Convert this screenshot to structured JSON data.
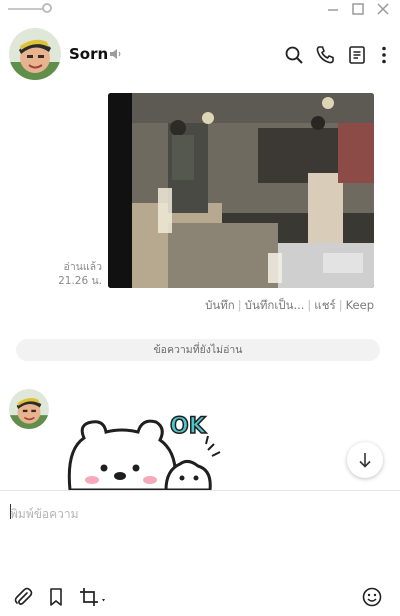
{
  "header": {
    "contact_name": "Sorn",
    "icons": [
      "search-icon",
      "phone-icon",
      "notes-icon",
      "more-icon"
    ]
  },
  "window_controls": [
    "minimize-icon",
    "maximize-icon",
    "close-icon"
  ],
  "message": {
    "read_label": "อ่านแล้ว",
    "time": "21.26 น.",
    "actions": [
      "บันทึก",
      "บันทึกเป็น...",
      "แชร์",
      "Keep"
    ]
  },
  "unread_divider": "ข้อความที่ยังไม่อ่าน",
  "sticker": {
    "text": "OK"
  },
  "composer": {
    "placeholder": "พิมพ์ข้อความ",
    "toolbar_icons": [
      "attach-icon",
      "bookmark-icon",
      "crop-icon",
      "emoji-icon"
    ]
  },
  "colors": {
    "accent": "#00b900",
    "divider_bg": "#f2f2f2",
    "muted_text": "#8a8a8a"
  }
}
